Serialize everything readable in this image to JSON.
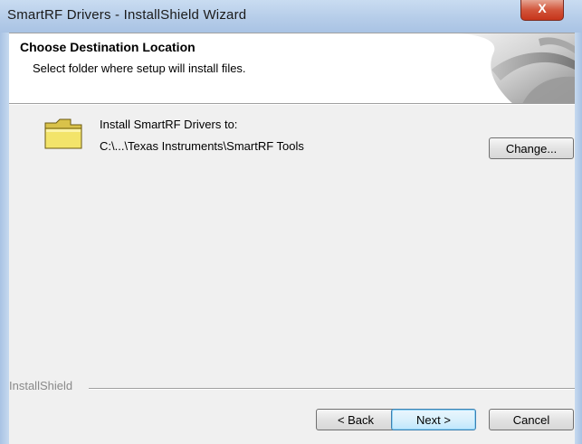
{
  "window": {
    "title": "SmartRF Drivers - InstallShield Wizard",
    "close_glyph": "X"
  },
  "header": {
    "title": "Choose Destination Location",
    "subtitle": "Select folder where setup will install files.",
    "art_icon": "installshield-banner-icon"
  },
  "main": {
    "folder_icon": "folder-icon",
    "install_label": "Install SmartRF Drivers to:",
    "install_path": "C:\\...\\Texas Instruments\\SmartRF Tools",
    "change_label": "Change..."
  },
  "footer": {
    "brand": "InstallShield",
    "back_label": "< Back",
    "next_label": "Next >",
    "cancel_label": "Cancel"
  },
  "colors": {
    "titlebar": "#b6cde9",
    "client_bg": "#f0f0f0",
    "close_button": "#c7351b"
  }
}
